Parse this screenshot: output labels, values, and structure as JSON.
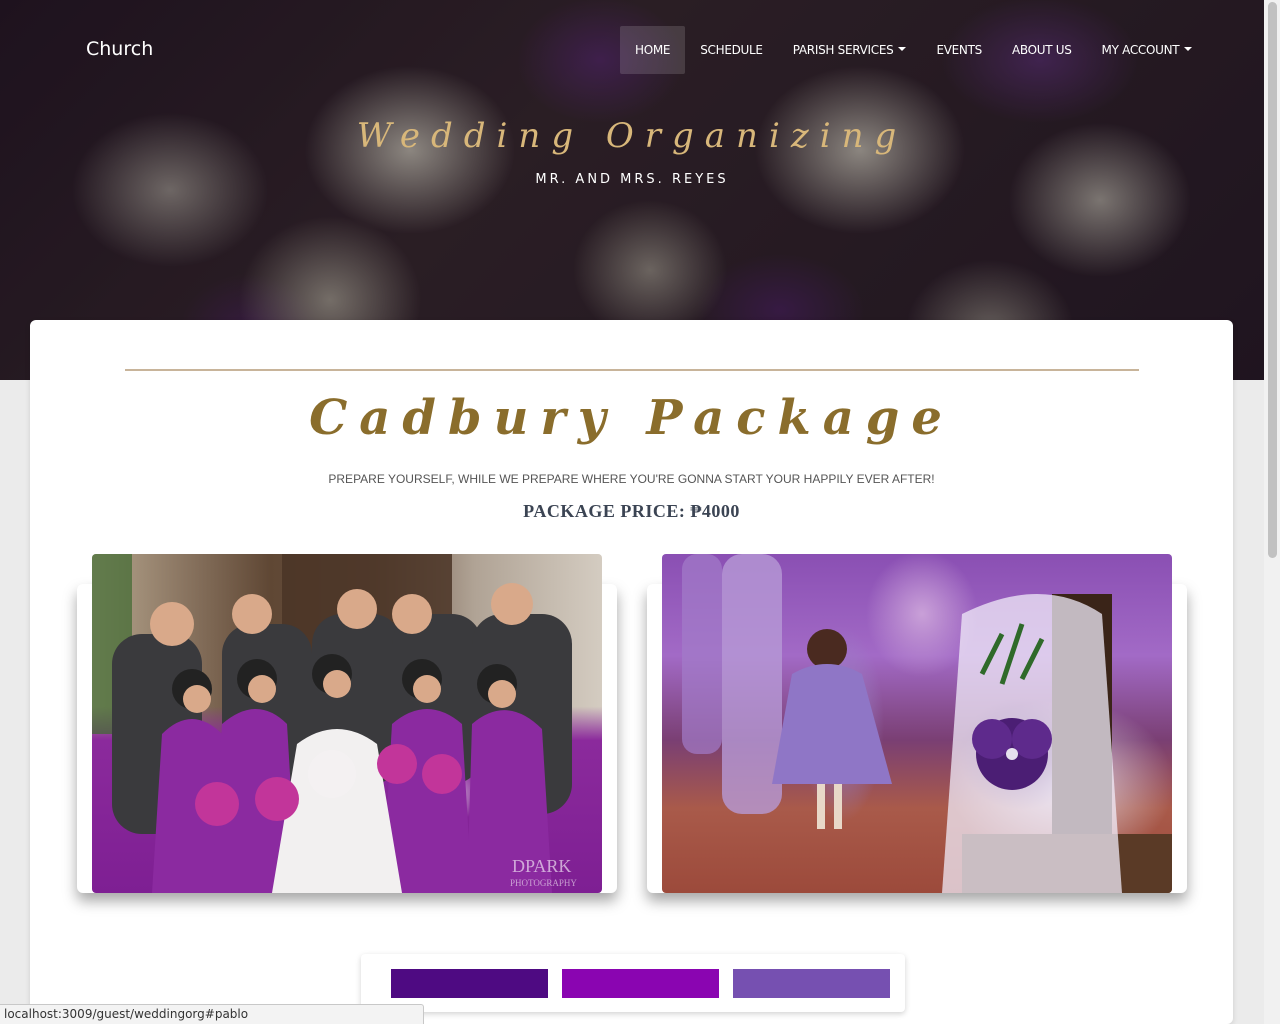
{
  "navbar": {
    "brand": "Church",
    "items": [
      {
        "label": "HOME",
        "active": true,
        "dropdown": false
      },
      {
        "label": "SCHEDULE",
        "active": false,
        "dropdown": false
      },
      {
        "label": "PARISH SERVICES",
        "active": false,
        "dropdown": true
      },
      {
        "label": "EVENTS",
        "active": false,
        "dropdown": false
      },
      {
        "label": "ABOUT US",
        "active": false,
        "dropdown": false
      },
      {
        "label": "MY ACCOUNT",
        "active": false,
        "dropdown": true
      }
    ]
  },
  "hero": {
    "title": "Wedding Organizing",
    "subtitle": "MR. AND MRS. REYES"
  },
  "package": {
    "title": "Cadbury Package",
    "tagline": "PREPARE YOURSELF, WHILE WE PREPARE WHERE YOU'RE GONNA START YOUR HAPPILY EVER AFTER!",
    "price": "PACKAGE PRICE: ₱4000"
  },
  "photos": {
    "left_watermark": "DPARK",
    "left_watermark_sub": "PHOTOGRAPHY"
  },
  "palette": {
    "colors": [
      "#4e0a82",
      "#8a05b1",
      "#7650b1"
    ]
  },
  "theme": {
    "gold": "#d8b77a",
    "title_gold": "#8a6d2c"
  },
  "status_bar": {
    "url": "localhost:3009/guest/weddingorg#pablo"
  }
}
